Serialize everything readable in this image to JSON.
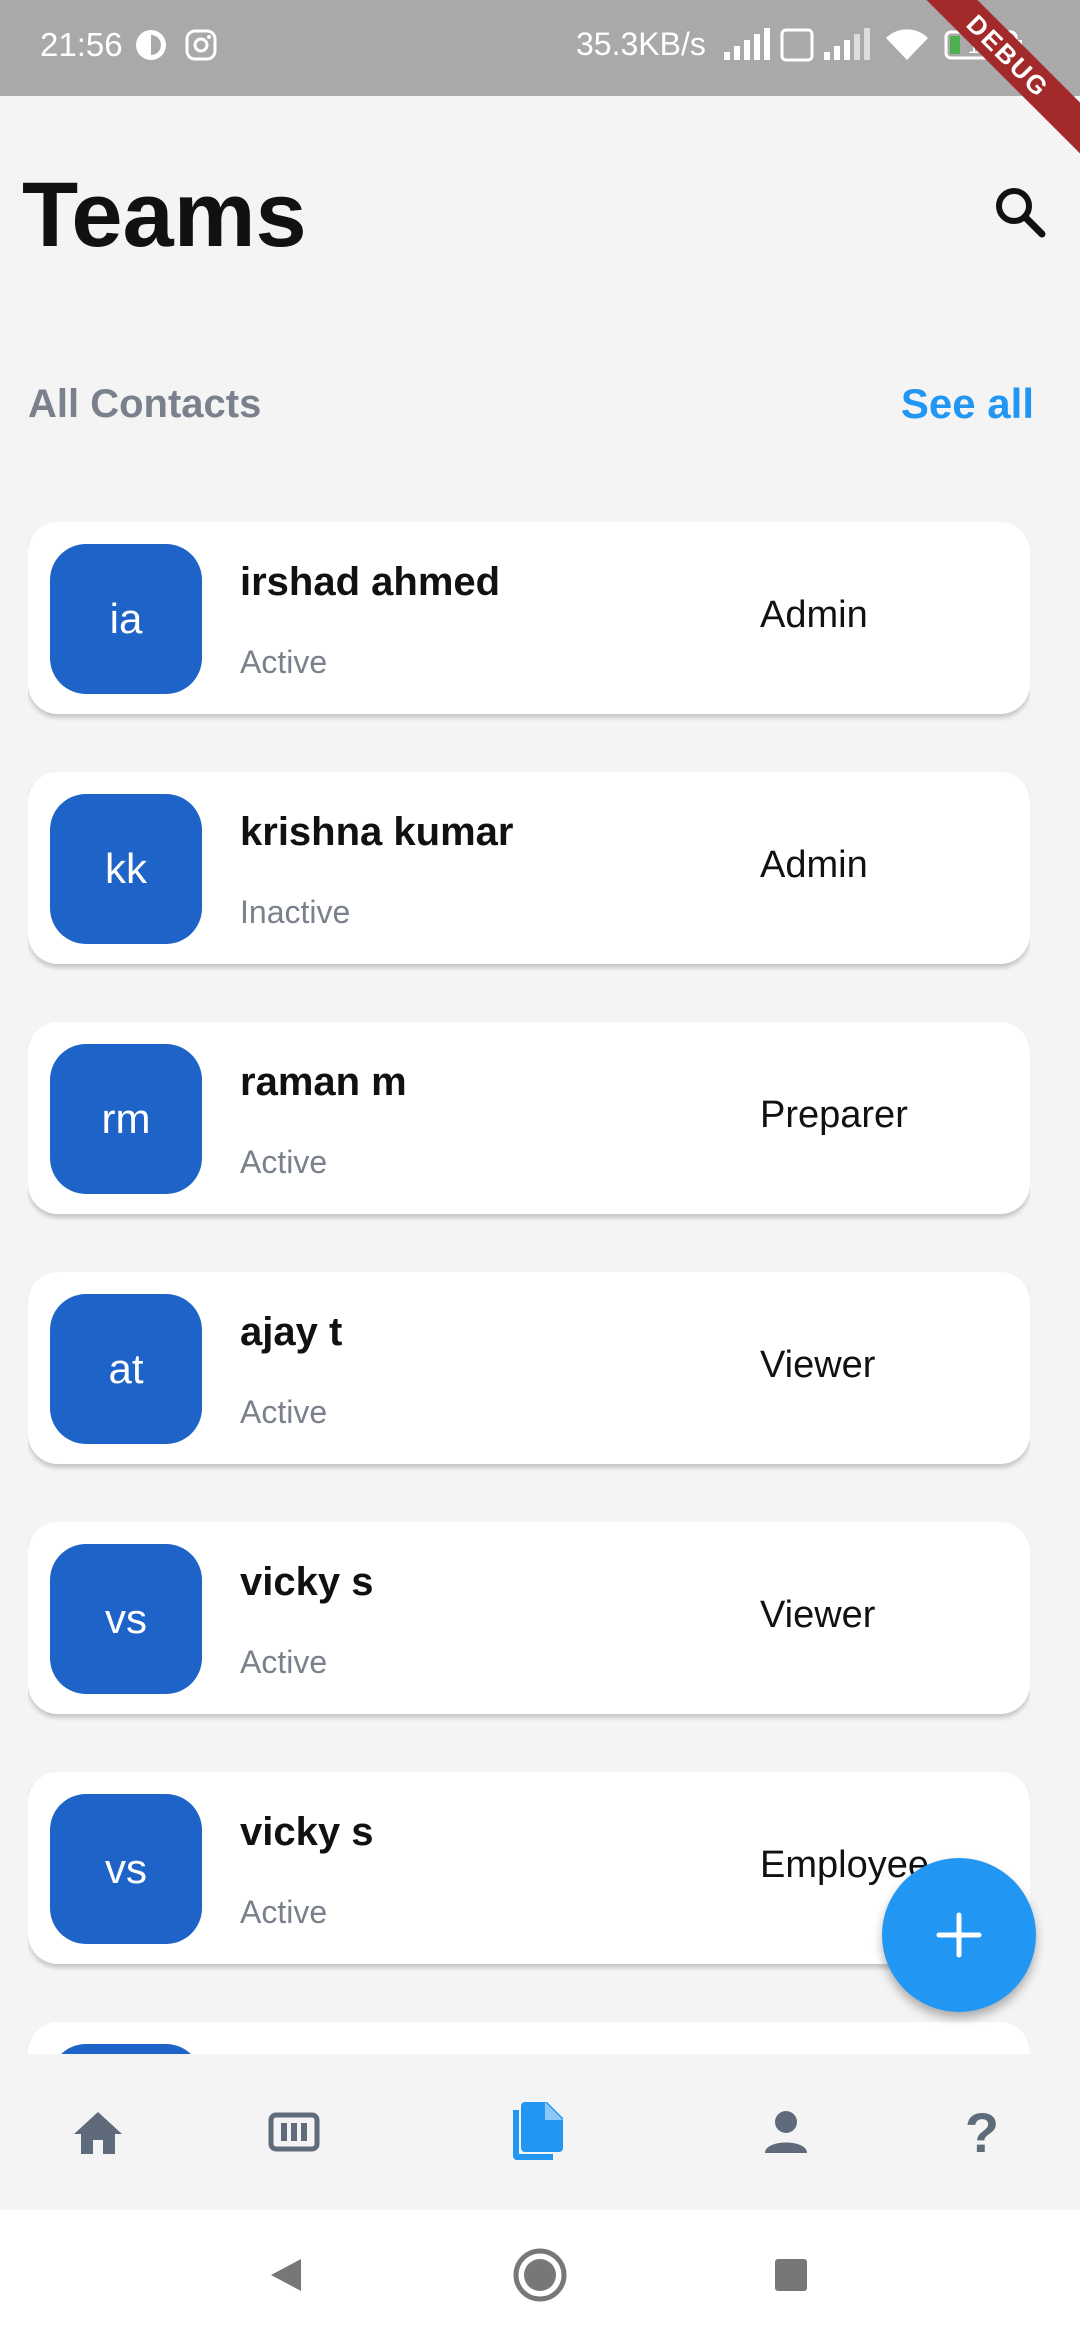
{
  "status_bar": {
    "time": "21:56",
    "network_speed": "35.3KB/s",
    "battery": "15",
    "debug_label": "DEBUG"
  },
  "header": {
    "title": "Teams"
  },
  "section": {
    "title": "All Contacts",
    "see_all": "See all"
  },
  "contacts": [
    {
      "initials": "ia",
      "name": "irshad ahmed",
      "status": "Active",
      "role": "Admin"
    },
    {
      "initials": "kk",
      "name": "krishna kumar",
      "status": "Inactive",
      "role": "Admin"
    },
    {
      "initials": "rm",
      "name": "raman m",
      "status": "Active",
      "role": "Preparer"
    },
    {
      "initials": "at",
      "name": "ajay t",
      "status": "Active",
      "role": "Viewer"
    },
    {
      "initials": "vs",
      "name": "vicky s",
      "status": "Active",
      "role": "Viewer"
    },
    {
      "initials": "vs",
      "name": "vicky s",
      "status": "Active",
      "role": "Employee"
    }
  ],
  "bottom_nav": {
    "items": [
      "home-icon",
      "dashboard-icon",
      "documents-icon",
      "person-icon",
      "help-icon"
    ],
    "active": "documents-icon",
    "help_glyph": "?"
  },
  "colors": {
    "accent": "#2196f3",
    "avatar": "#1e63c7",
    "muted": "#7a818d",
    "nav_icon": "#5f6b7a"
  }
}
